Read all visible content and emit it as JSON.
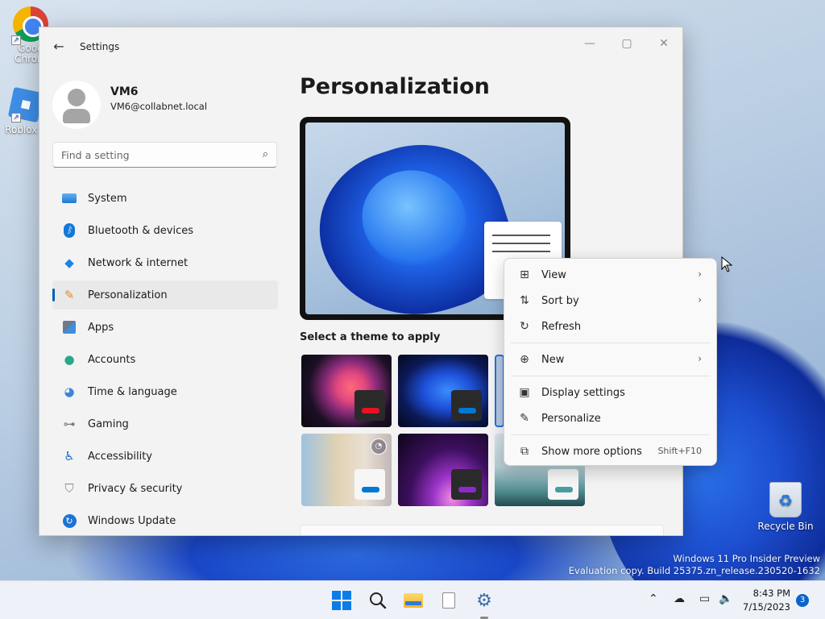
{
  "desktop": {
    "icons": [
      {
        "label": "Goog Chrom"
      },
      {
        "label": "Roblox S"
      },
      {
        "label": "Recycle Bin"
      }
    ],
    "watermark": {
      "line1": "Windows 11 Pro Insider Preview",
      "line2": "Evaluation copy. Build 25375.zn_release.230520-1632"
    }
  },
  "window": {
    "title": "Settings",
    "back_icon": "arrow-left-icon",
    "controls": {
      "minimize": "—",
      "maximize": "▢",
      "close": "✕"
    },
    "user": {
      "name": "VM6",
      "email": "VM6@collabnet.local"
    },
    "search": {
      "placeholder": "Find a setting",
      "icon": "search-icon"
    },
    "nav": [
      {
        "label": "System",
        "icon": "monitor-icon"
      },
      {
        "label": "Bluetooth & devices",
        "icon": "bluetooth-icon"
      },
      {
        "label": "Network & internet",
        "icon": "wifi-icon"
      },
      {
        "label": "Personalization",
        "icon": "brush-icon",
        "active": true
      },
      {
        "label": "Apps",
        "icon": "apps-icon"
      },
      {
        "label": "Accounts",
        "icon": "person-icon"
      },
      {
        "label": "Time & language",
        "icon": "globe-clock-icon"
      },
      {
        "label": "Gaming",
        "icon": "gamepad-icon"
      },
      {
        "label": "Accessibility",
        "icon": "accessibility-icon"
      },
      {
        "label": "Privacy & security",
        "icon": "shield-icon"
      },
      {
        "label": "Windows Update",
        "icon": "update-icon"
      }
    ],
    "page_title": "Personalization",
    "theme_section_label": "Select a theme to apply",
    "themes": [
      {
        "accent": "#e81123"
      },
      {
        "accent": "#0078d4"
      },
      {
        "accent": "#2a6fdb",
        "selected": true
      },
      {
        "accent": "#0078d4"
      },
      {
        "accent": "#8a2ac8"
      },
      {
        "accent": "#4a9ba0"
      }
    ]
  },
  "context_menu": {
    "items": [
      {
        "label": "View",
        "icon": "grid-icon",
        "submenu": true
      },
      {
        "label": "Sort by",
        "icon": "sort-icon",
        "submenu": true
      },
      {
        "label": "Refresh",
        "icon": "refresh-icon"
      },
      {
        "label": "New",
        "icon": "plus-circle-icon",
        "submenu": true
      },
      {
        "label": "Display settings",
        "icon": "display-settings-icon"
      },
      {
        "label": "Personalize",
        "icon": "pen-icon"
      },
      {
        "label": "Show more options",
        "icon": "open-external-icon",
        "shortcut": "Shift+F10"
      }
    ]
  },
  "taskbar": {
    "clock": {
      "time": "8:43 PM",
      "date": "7/15/2023"
    },
    "notification_count": "3"
  }
}
